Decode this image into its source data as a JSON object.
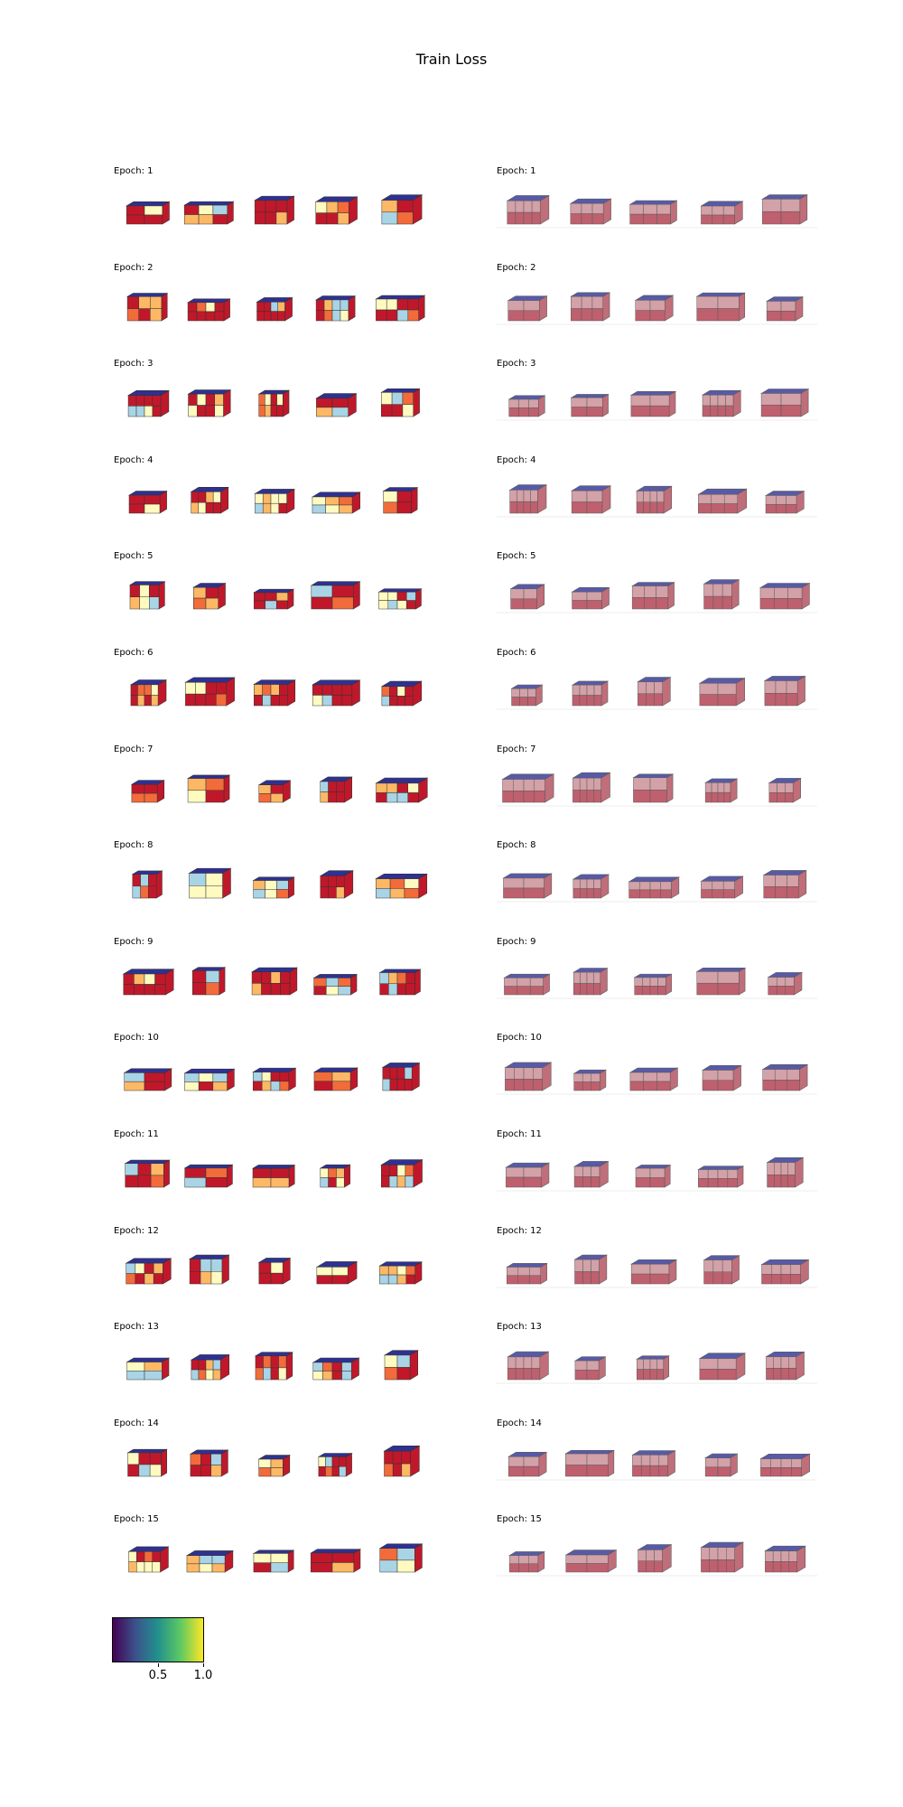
{
  "title": "Train Loss",
  "columns": [
    {
      "style": "crisp",
      "epoch_prefix": "Epoch: "
    },
    {
      "style": "blurry",
      "epoch_prefix": "Epoch: "
    }
  ],
  "epochs": [
    "1",
    "2",
    "3",
    "4",
    "5",
    "6",
    "7",
    "8",
    "9",
    "10",
    "11",
    "12",
    "13",
    "14",
    "15"
  ],
  "colorbar": {
    "cmap": "viridis",
    "tick_labels": [
      "0.5",
      "1.0"
    ],
    "tick_values": [
      0.5,
      1.0
    ],
    "range": [
      0.0,
      1.0
    ]
  },
  "palette": {
    "top": "#2e3192",
    "red": "#c0182a",
    "orange": "#f26b3a",
    "peach": "#fdb865",
    "pale": "#fffac0",
    "lightblue": "#a9d4e6",
    "edge": "#333333",
    "bg": "#ffffff"
  }
}
